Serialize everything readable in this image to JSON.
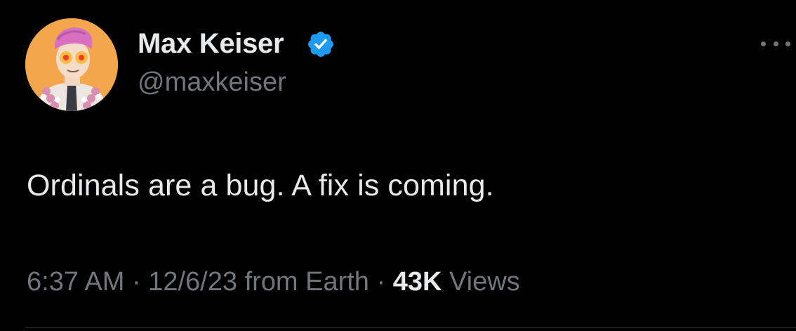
{
  "author": {
    "display_name": "Max Keiser",
    "handle": "@maxkeiser",
    "verified": true,
    "verified_color": "#1d9bf0",
    "avatar_icon": "profile-avatar-laser-eyes"
  },
  "tweet": {
    "text": "Ordinals are a bug. A fix is coming."
  },
  "meta": {
    "time": "6:37 AM",
    "separator": "·",
    "date": "12/6/23",
    "location": "from Earth",
    "views_count": "43K",
    "views_label": "Views"
  },
  "colors": {
    "background": "#000000",
    "primary_text": "#e7e9ea",
    "secondary_text": "#71767b",
    "divider": "#2f3336"
  },
  "more_icon": "more-horizontal-icon"
}
